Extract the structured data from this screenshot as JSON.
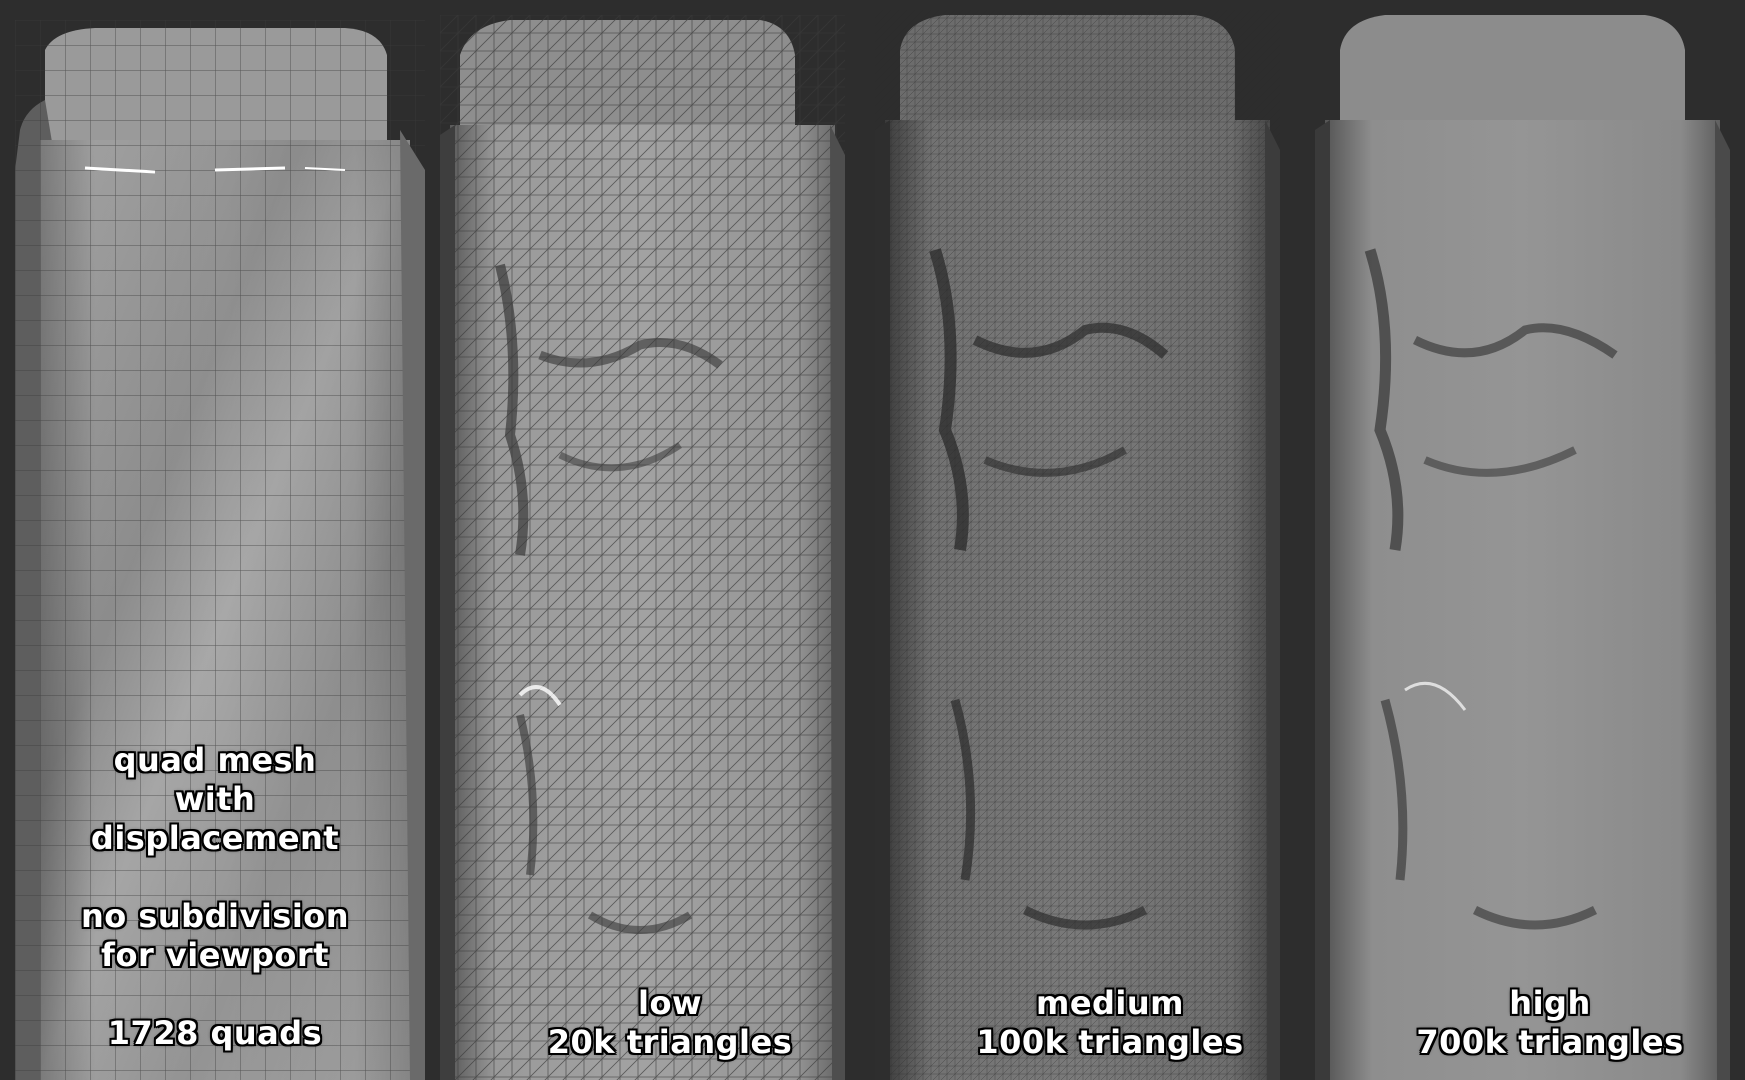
{
  "panels": [
    {
      "id": "quad",
      "caption": {
        "line1": "quad mesh",
        "line2": "with",
        "line3": "displacement",
        "line4": "no subdivision",
        "line5": "for viewport",
        "line6": "1728 quads"
      },
      "base_color": "#9c9c9c"
    },
    {
      "id": "low",
      "caption": {
        "line1": "low",
        "line2": "20k triangles"
      },
      "base_color": "#8e8e8e"
    },
    {
      "id": "medium",
      "caption": {
        "line1": "medium",
        "line2": "100k triangles"
      },
      "base_color": "#6f6f6f"
    },
    {
      "id": "high",
      "caption": {
        "line1": "high",
        "line2": "700k triangles"
      },
      "base_color": "#8a8a8a"
    }
  ],
  "background_color": "#2d2d2d"
}
